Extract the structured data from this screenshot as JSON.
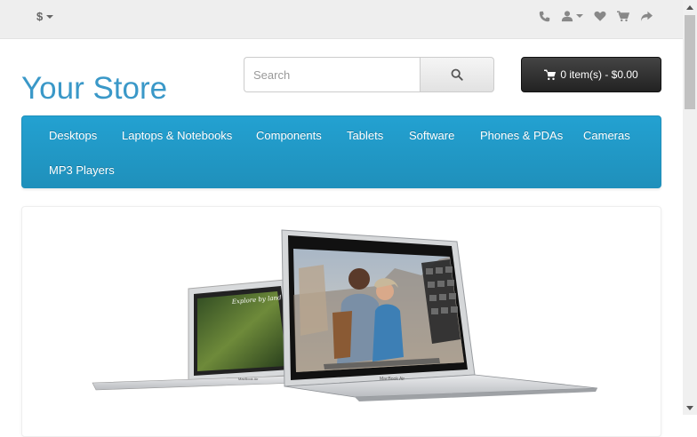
{
  "topbar": {
    "currency_symbol": "$",
    "icons": [
      "phone-icon",
      "user-icon",
      "heart-icon",
      "shopping-cart-icon",
      "share-icon"
    ]
  },
  "logo": {
    "text": "Your Store"
  },
  "search": {
    "placeholder": "Search",
    "value": ""
  },
  "cart": {
    "label": "0 item(s) - $0.00"
  },
  "menu": {
    "items": [
      "Desktops",
      "Laptops & Notebooks",
      "Components",
      "Tablets",
      "Software",
      "Phones & PDAs",
      "Cameras",
      "MP3 Players"
    ]
  },
  "slideshow": {
    "laptop_front": {
      "brand": "MacBook Air"
    },
    "laptop_back": {
      "brand": "MacBook Air",
      "screen_text": "Explore by land"
    }
  },
  "colors": {
    "accent": "#229ac8",
    "logo": "#3a98c8",
    "cart_bg": "#333333",
    "topbar_bg": "#eeeeee"
  }
}
